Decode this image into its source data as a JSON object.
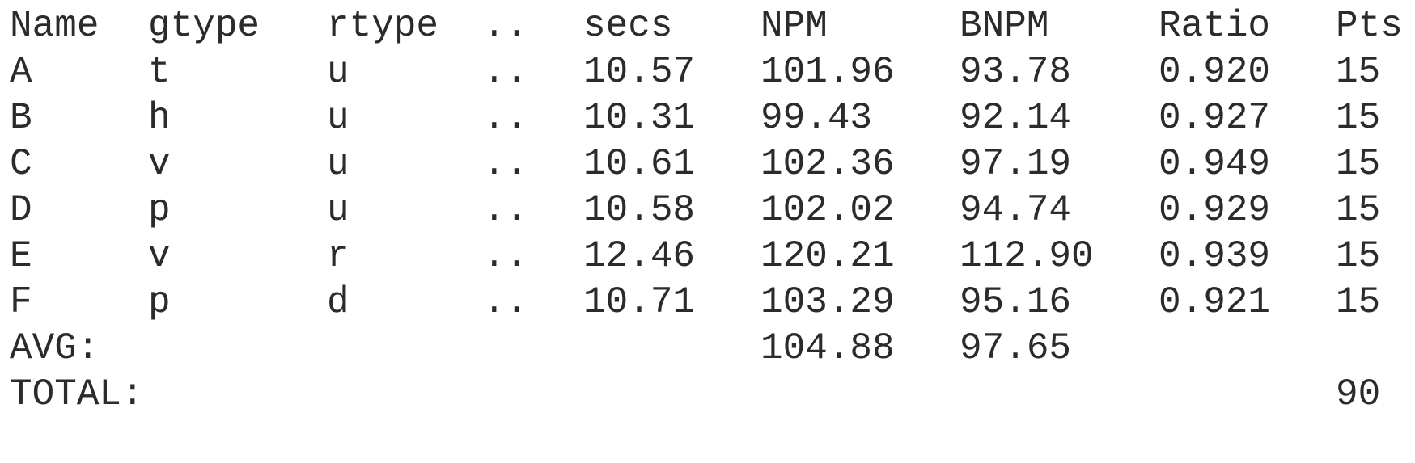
{
  "header": {
    "name": "Name",
    "gtype": "gtype",
    "rtype": "rtype",
    "dots": "..",
    "secs": "secs",
    "npm": "NPM",
    "bnpm": "BNPM",
    "ratio": "Ratio",
    "pts": "Pts"
  },
  "rows": [
    {
      "name": "A",
      "gtype": "t",
      "rtype": "u",
      "dots": "..",
      "secs": "10.57",
      "npm": "101.96",
      "bnpm": "93.78",
      "ratio": "0.920",
      "pts": "15"
    },
    {
      "name": "B",
      "gtype": "h",
      "rtype": "u",
      "dots": "..",
      "secs": "10.31",
      "npm": "99.43",
      "bnpm": "92.14",
      "ratio": "0.927",
      "pts": "15"
    },
    {
      "name": "C",
      "gtype": "v",
      "rtype": "u",
      "dots": "..",
      "secs": "10.61",
      "npm": "102.36",
      "bnpm": "97.19",
      "ratio": "0.949",
      "pts": "15"
    },
    {
      "name": "D",
      "gtype": "p",
      "rtype": "u",
      "dots": "..",
      "secs": "10.58",
      "npm": "102.02",
      "bnpm": "94.74",
      "ratio": "0.929",
      "pts": "15"
    },
    {
      "name": "E",
      "gtype": "v",
      "rtype": "r",
      "dots": "..",
      "secs": "12.46",
      "npm": "120.21",
      "bnpm": "112.90",
      "ratio": "0.939",
      "pts": "15"
    },
    {
      "name": "F",
      "gtype": "p",
      "rtype": "d",
      "dots": "..",
      "secs": "10.71",
      "npm": "103.29",
      "bnpm": "95.16",
      "ratio": "0.921",
      "pts": "15"
    }
  ],
  "avg": {
    "label": "AVG:",
    "npm": "104.88",
    "bnpm": "97.65"
  },
  "total": {
    "label": "TOTAL:",
    "pts": "90"
  }
}
